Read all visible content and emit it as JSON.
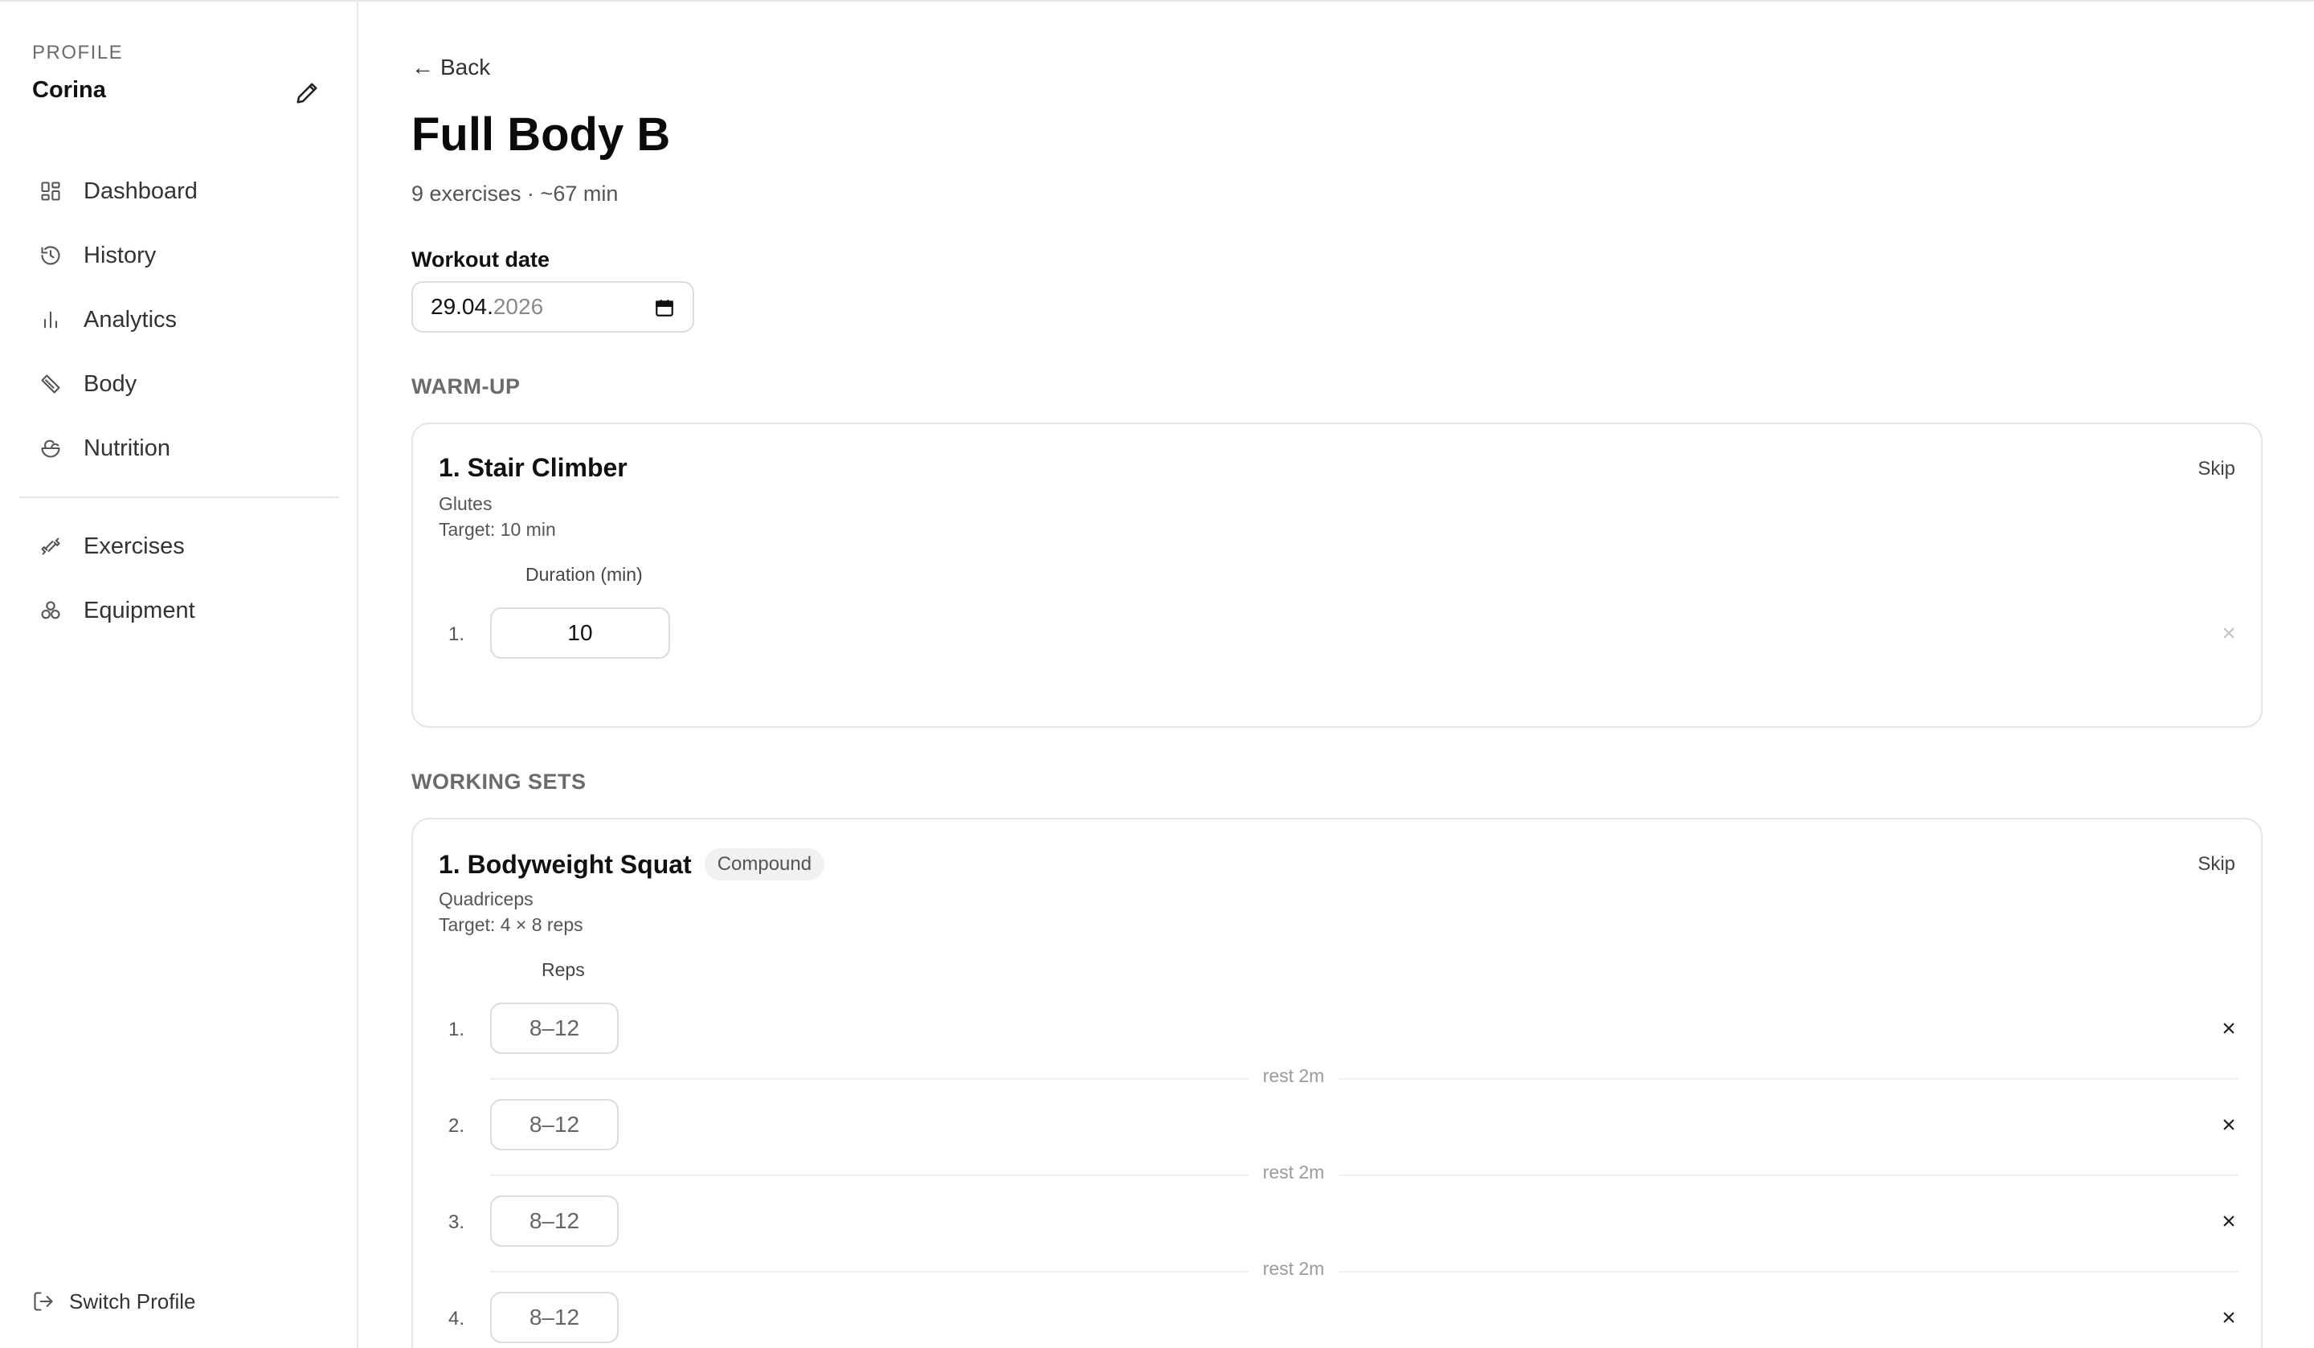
{
  "sidebar": {
    "profile_caption": "PROFILE",
    "profile_name": "Corina",
    "edit_icon": "pencil-icon",
    "nav_primary": [
      {
        "label": "Dashboard",
        "icon": "dashboard-grid-icon"
      },
      {
        "label": "History",
        "icon": "history-clock-icon"
      },
      {
        "label": "Analytics",
        "icon": "bar-chart-icon"
      },
      {
        "label": "Body",
        "icon": "ruler-icon"
      },
      {
        "label": "Nutrition",
        "icon": "salad-bowl-icon"
      }
    ],
    "nav_secondary": [
      {
        "label": "Exercises",
        "icon": "dumbbell-icon"
      },
      {
        "label": "Equipment",
        "icon": "weights-icon"
      }
    ],
    "switch_profile": {
      "label": "Switch Profile",
      "icon": "log-out-icon"
    }
  },
  "main": {
    "back_label": "Back",
    "title": "Full Body B",
    "subtitle": "9 exercises · ~67 min",
    "date_label": "Workout date",
    "date_value_day_month": "29.04.",
    "date_value_year": "2026",
    "calendar_icon": "calendar-icon",
    "sections": [
      {
        "heading": "WARM-UP",
        "exercise": {
          "title": "1. Stair Climber",
          "badge": "",
          "skip_label": "Skip",
          "muscle": "Glutes",
          "target": "Target: 10 min",
          "column": "Duration (min)",
          "sets": [
            {
              "num": "1.",
              "value": "10"
            }
          ]
        }
      },
      {
        "heading": "WORKING SETS",
        "exercise": {
          "title": "1. Bodyweight Squat",
          "badge": "Compound",
          "skip_label": "Skip",
          "muscle": "Quadriceps",
          "target": "Target: 4 × 8 reps",
          "column": "Reps",
          "sets": [
            {
              "num": "1.",
              "placeholder": "8–12"
            },
            {
              "num": "2.",
              "placeholder": "8–12"
            },
            {
              "num": "3.",
              "placeholder": "8–12"
            },
            {
              "num": "4.",
              "placeholder": "8–12"
            }
          ],
          "rest_label": "rest 2m"
        }
      }
    ]
  }
}
